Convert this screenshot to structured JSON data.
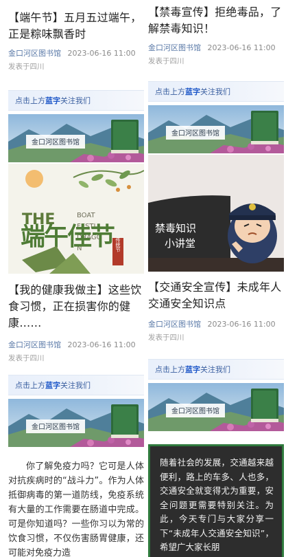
{
  "left": {
    "card1": {
      "title": "【端午节】五月五过端午，正是粽味飘香时",
      "author": "金口河区图书馆",
      "datetime": "2023-06-16 11:00",
      "location": "发表于四川"
    },
    "follow1": {
      "pre": "点击上方",
      "highlight": "蓝字",
      "post": "关注我们"
    },
    "banner1_logo": "金口河区图书馆",
    "poster_dragon": {
      "headline": "端午佳节",
      "the": "THE",
      "en1": "BOAT",
      "en2": "FESTI",
      "en3": "DRAGO",
      "en4": "N",
      "seal": "传统节"
    },
    "card2": {
      "title": "【我的健康我做主】这些饮食习惯，正在损害你的健康……",
      "author": "金口河区图书馆",
      "datetime": "2023-06-16 11:00",
      "location": "发表于四川"
    },
    "follow2": {
      "pre": "点击上方",
      "highlight": "蓝字",
      "post": "关注我们"
    },
    "banner2_logo": "金口河区图书馆",
    "body_text": "你了解免疫力吗？它可是人体对抗疾病时的“战斗力”。作为人体抵御病毒的第一道防线，免疫系统有大量的工作需要在肠道中完成。可是你知道吗？一些你习以为常的饮食习惯，不仅伤害肠胃健康，还可能对免疫力造"
  },
  "right": {
    "card1": {
      "title": "【禁毒宣传】拒绝毒品，了解禁毒知识！",
      "author": "金口河区图书馆",
      "datetime": "2023-06-16 11:00",
      "location": "发表于四川"
    },
    "follow1": {
      "pre": "点击上方",
      "highlight": "蓝字",
      "post": "关注我们"
    },
    "banner1_logo": "金口河区图书馆",
    "poster_drug": {
      "caption": "禁毒知识小讲堂"
    },
    "card2": {
      "title": "【交通安全宣传】未成年人交通安全知识点",
      "author": "金口河区图书馆",
      "datetime": "2023-06-16 11:00",
      "location": "发表于四川"
    },
    "follow2": {
      "pre": "点击上方",
      "highlight": "蓝字",
      "post": "关注我们"
    },
    "banner2_logo": "金口河区图书馆",
    "body_text": "随着社会的发展，交通越来越便利，路上的车多、人也多，交通安全就变得尤为重要，安全问题更需要特别关注。为此，今天专门与大家分享一下“未成年人交通安全知识”，希望广大家长朋"
  },
  "colors": {
    "author": "#5b7aa8",
    "follow_highlight": "#1d57c8",
    "dark_box_border": "#2f7a3d"
  }
}
